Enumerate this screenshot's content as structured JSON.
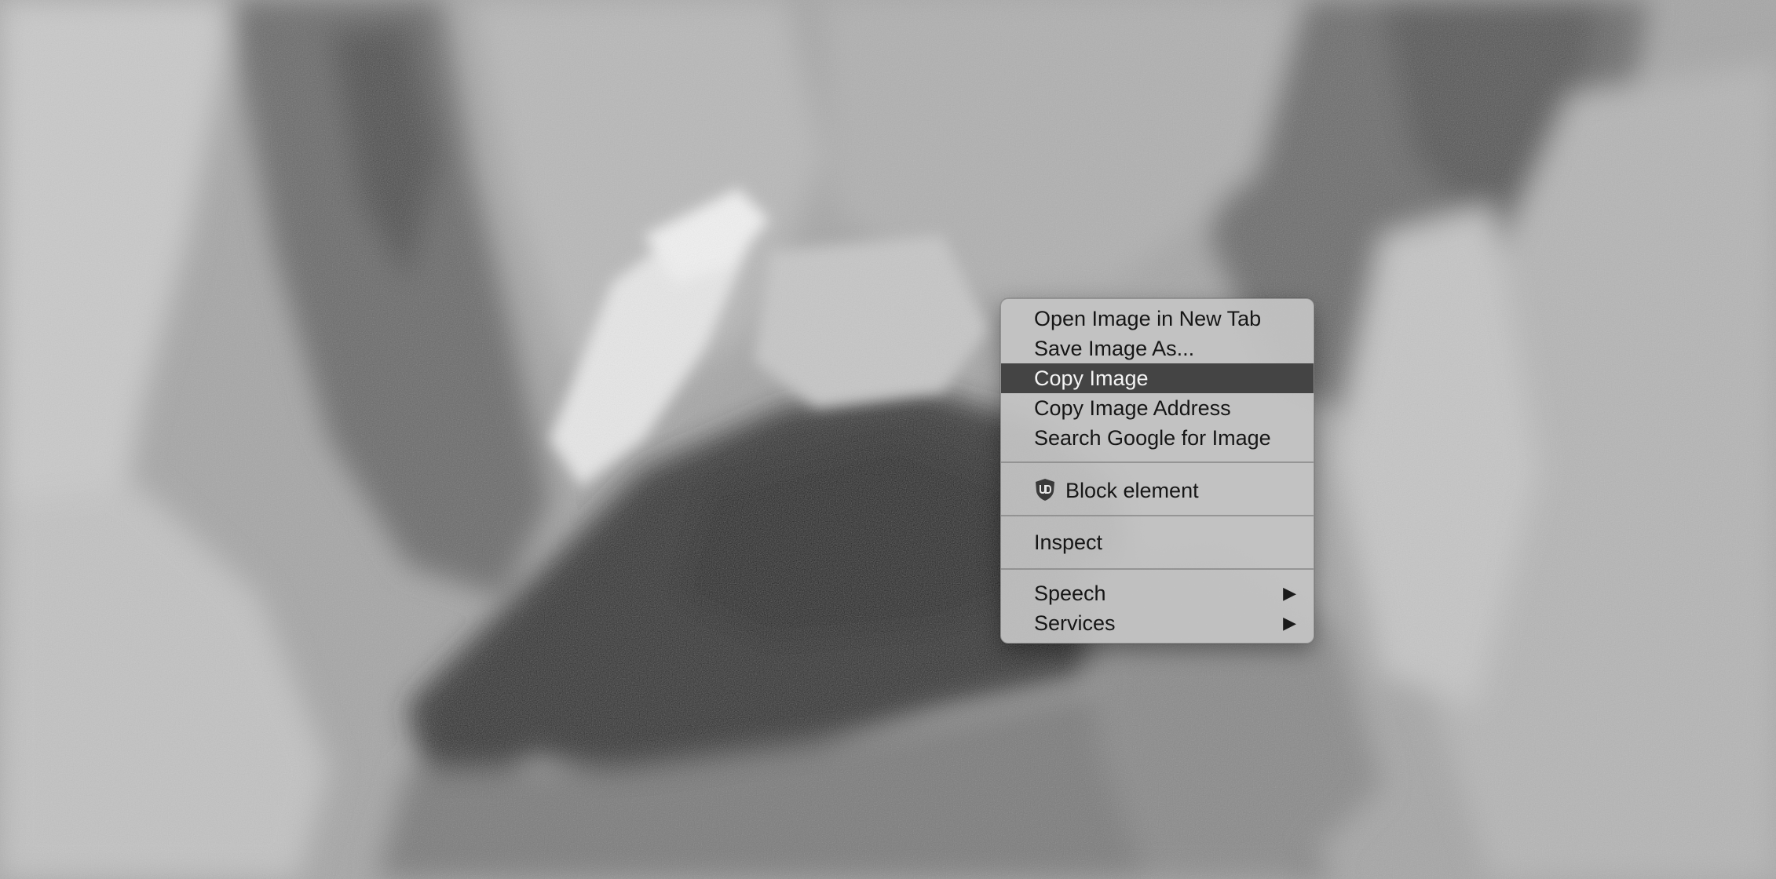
{
  "menu": {
    "items": [
      {
        "label": "Open Image in New Tab"
      },
      {
        "label": "Save Image As..."
      },
      {
        "label": "Copy Image",
        "highlighted": true
      },
      {
        "label": "Copy Image Address"
      },
      {
        "label": "Search Google for Image"
      }
    ],
    "block_element": {
      "label": "Block element",
      "icon": "ublock-origin-icon"
    },
    "inspect": {
      "label": "Inspect"
    },
    "speech": {
      "label": "Speech",
      "arrow": "▶"
    },
    "services": {
      "label": "Services",
      "arrow": "▶"
    }
  },
  "colors": {
    "menu_bg": "#c4c4c4",
    "highlight": "#444444",
    "highlight_text": "#f4f4f4",
    "text": "#161616"
  }
}
